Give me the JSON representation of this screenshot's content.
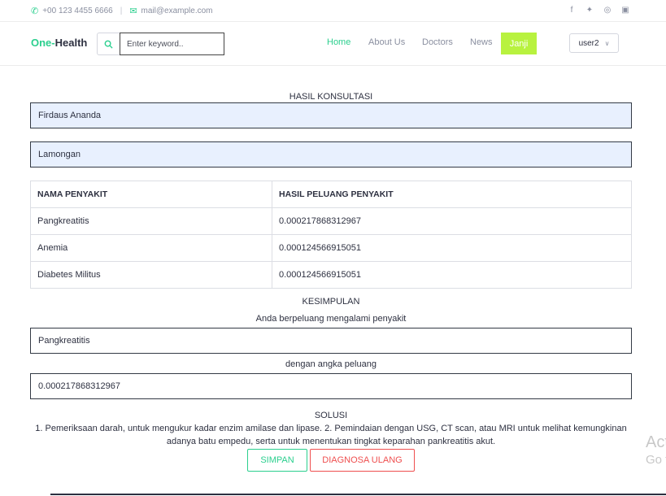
{
  "topbar": {
    "phone": "+00 123 4455 6666",
    "separator": "|",
    "email": "mail@example.com",
    "phone_icon": "phone-icon",
    "email_icon": "envelope-icon",
    "social": [
      "facebook-icon",
      "twitter-icon",
      "dribbble-icon",
      "instagram-icon"
    ]
  },
  "navbar": {
    "brand_part1": "One-",
    "brand_part2": "Health",
    "search_placeholder": "Enter keyword..",
    "links": [
      {
        "label": "Home",
        "active": true
      },
      {
        "label": "About Us",
        "active": false
      },
      {
        "label": "Doctors",
        "active": false
      },
      {
        "label": "News",
        "active": false
      }
    ],
    "cta": "Janji",
    "user": "user2"
  },
  "hasil": {
    "title": "HASIL KONSULTASI",
    "nama": "Firdaus Ananda",
    "alamat": "Lamongan"
  },
  "table": {
    "headers": [
      "NAMA PENYAKIT",
      "HASIL PELUANG PENYAKIT"
    ],
    "rows": [
      [
        "Pangkreatitis",
        "0.000217868312967"
      ],
      [
        "Anemia",
        "0.000124566915051"
      ],
      [
        "Diabetes Militus",
        "0.000124566915051"
      ]
    ]
  },
  "kesimpulan": {
    "title": "KESIMPULAN",
    "intro": "Anda berpeluang mengalami penyakit",
    "penyakit": "Pangkreatitis",
    "angka_label": "dengan angka peluang",
    "angka": "0.000217868312967"
  },
  "solusi": {
    "title": "SOLUSI",
    "text": "1. Pemeriksaan darah, untuk mengukur kadar enzim amilase dan lipase. 2. Pemindaian dengan USG, CT scan, atau MRI untuk melihat kemungkinan adanya batu empedu, serta untuk menentukan tingkat keparahan pankreatitis akut."
  },
  "buttons": {
    "simpan": "SIMPAN",
    "ulang": "DIAGNOSA ULANG"
  },
  "watermark": {
    "line1": "Act",
    "line2": "Go to"
  },
  "colors": {
    "accent": "#2bcf8e",
    "cta": "#b8f23f",
    "danger": "#ef4f4f",
    "input_fill": "#e8f0fe"
  }
}
